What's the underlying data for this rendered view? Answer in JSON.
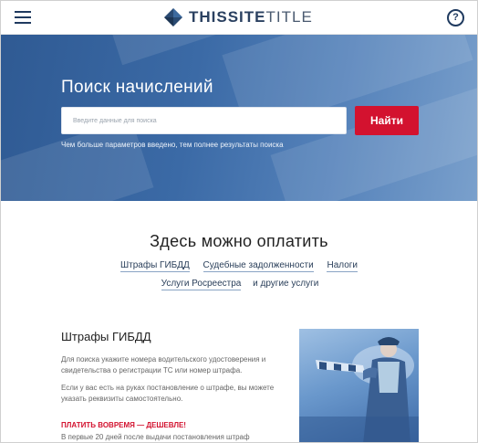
{
  "header": {
    "menu_icon": "hamburger-menu-icon",
    "logo_icon": "diamond-logo-icon",
    "logo_bold": "THISSITE",
    "logo_light": "TITLE",
    "help_icon": "question-circle-icon",
    "help_glyph": "?"
  },
  "hero": {
    "title": "Поиск начислений",
    "search_placeholder": "Введите данные для поиска",
    "search_button": "Найти",
    "hint": "Чем больше параметров введено, тем полнее результаты поиска"
  },
  "payments": {
    "title": "Здесь можно оплатить",
    "links": [
      "Штрафы ГИБДД",
      "Судебные задолженности",
      "Налоги",
      "Услуги Росреестра"
    ],
    "other": "и другие услуги"
  },
  "fines": {
    "title": "Штрафы ГИБДД",
    "p1": "Для поиска укажите номера водительского удостоверения и свидетельства о регистрации ТС или номер штрафа.",
    "p2": "Если у вас есть на руках постановление о штрафе, вы можете указать реквизиты самостоятельно.",
    "warn": "ПЛАТИТЬ ВОВРЕМЯ — ДЕШЕВЛЕ!",
    "p3": "В первые 20 дней после выдачи постановления штраф",
    "photo_icon": "traffic-police-photo"
  },
  "colors": {
    "accent": "#d3122f",
    "hero_blue": "#3b6aa6",
    "navy": "#1f3a5f"
  }
}
